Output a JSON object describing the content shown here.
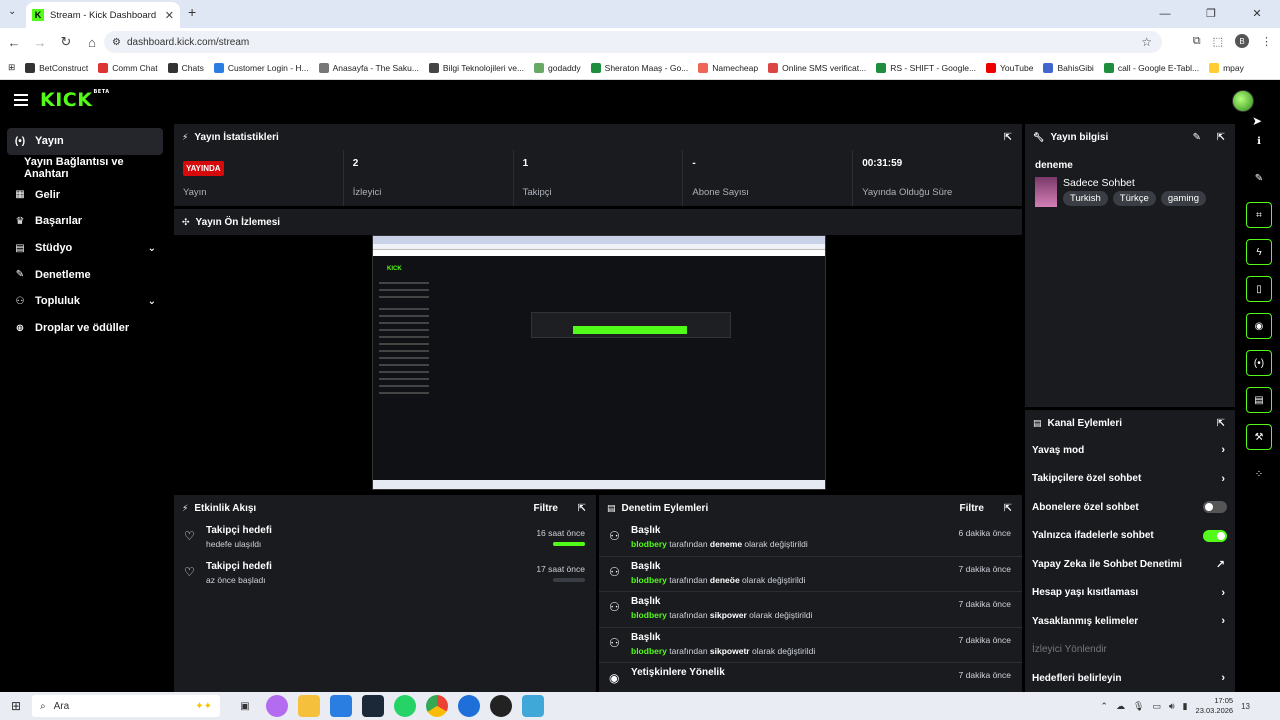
{
  "browser": {
    "tab_title": "Stream - Kick Dashboard",
    "url": "dashboard.kick.com/stream",
    "profile_initial": "B",
    "bookmarks": [
      "BetConstruct",
      "Comm Chat",
      "Chats",
      "Customer Login - H...",
      "Anasayfa - The Saku...",
      "Bilgi Teknolojileri ve...",
      "godaddy",
      "Sheraton Maaş - Go...",
      "Namecheap",
      "Online SMS verificat...",
      "RS - SHIFT - Google...",
      "YouTube",
      "BahisGibi",
      "call - Google E-Tabl...",
      "mpay"
    ]
  },
  "app": {
    "logo": "KICK",
    "logo_badge": "BETA"
  },
  "sidebar": {
    "items": [
      {
        "label": "Yayın",
        "icon": "broadcast-icon"
      },
      {
        "label": "Yayın Bağlantısı ve Anahtarı",
        "icon": ""
      },
      {
        "label": "Gelir",
        "icon": "revenue-icon"
      },
      {
        "label": "Başarılar",
        "icon": "trophy-icon"
      },
      {
        "label": "Stüdyo",
        "icon": "studio-icon"
      },
      {
        "label": "Denetleme",
        "icon": "wrench-icon"
      },
      {
        "label": "Topluluk",
        "icon": "community-icon"
      },
      {
        "label": "Droplar ve ödüller",
        "icon": "gift-icon"
      }
    ]
  },
  "stats_panel": {
    "title": "Yayın İstatistikleri",
    "live_badge": "YAYINDA",
    "stats": [
      {
        "value": "",
        "label": "Yayın"
      },
      {
        "value": "2",
        "label": "İzleyici"
      },
      {
        "value": "1",
        "label": "Takipçi"
      },
      {
        "value": "-",
        "label": "Abone Sayısı"
      },
      {
        "value": "00:31:59",
        "label": "Yayında Olduğu Süre"
      }
    ]
  },
  "preview_panel": {
    "title": "Yayın Ön İzlemesi"
  },
  "activity_panel": {
    "title": "Etkinlik Akışı",
    "filter": "Filtre",
    "items": [
      {
        "title": "Takipçi hedefi",
        "subtitle": "hedefe ulaşıldı",
        "time": "16 saat önce",
        "progress": 1.0
      },
      {
        "title": "Takipçi hedefi",
        "subtitle": "az önce başladı",
        "time": "17 saat önce",
        "progress": 0.0
      }
    ]
  },
  "moderation_panel": {
    "title": "Denetim Eylemleri",
    "filter": "Filtre",
    "items": [
      {
        "title": "Başlık",
        "user": "blodbery",
        "mid": "tarafından",
        "value": "deneme",
        "tail": "olarak değiştirildi",
        "time": "6 dakika önce"
      },
      {
        "title": "Başlık",
        "user": "blodbery",
        "mid": "tarafından",
        "value": "deneöe",
        "tail": "olarak değiştirildi",
        "time": "7 dakika önce"
      },
      {
        "title": "Başlık",
        "user": "blodbery",
        "mid": "tarafından",
        "value": "sikpower",
        "tail": "olarak değiştirildi",
        "time": "7 dakika önce"
      },
      {
        "title": "Başlık",
        "user": "blodbery",
        "mid": "tarafından",
        "value": "sikpowetr",
        "tail": "olarak değiştirildi",
        "time": "7 dakika önce"
      },
      {
        "title": "Yetişkinlere Yönelik",
        "user": "",
        "mid": "",
        "value": "",
        "tail": "",
        "time": "7 dakika önce"
      }
    ]
  },
  "info_panel": {
    "title": "Yayın bilgisi",
    "stream_title": "deneme",
    "category": "Sadece Sohbet",
    "tags": [
      "Turkish",
      "Türkçe",
      "gaming"
    ]
  },
  "actions_panel": {
    "title": "Kanal Eylemleri",
    "items": [
      {
        "label": "Yavaş mod",
        "control": "chevron"
      },
      {
        "label": "Takipçilere özel sohbet",
        "control": "chevron"
      },
      {
        "label": "Abonelere özel sohbet",
        "control": "toggle-off"
      },
      {
        "label": "Yalnızca ifadelerle sohbet",
        "control": "toggle-on"
      },
      {
        "label": "Yapay Zeka ile Sohbet Denetimi",
        "control": "external"
      },
      {
        "label": "Hesap yaşı kısıtlaması",
        "control": "chevron"
      },
      {
        "label": "Yasaklanmış kelimeler",
        "control": "chevron"
      },
      {
        "label": "İzleyici Yönlendir",
        "control": "disabled"
      },
      {
        "label": "Hedefleri belirleyin",
        "control": "chevron"
      }
    ]
  },
  "taskbar": {
    "search_placeholder": "Ara",
    "time": "17:05",
    "date": "23.03.2026",
    "notif_count": "13"
  },
  "colors": {
    "accent": "#53fc18",
    "live": "#d60a0a",
    "panel": "#191b1f"
  }
}
